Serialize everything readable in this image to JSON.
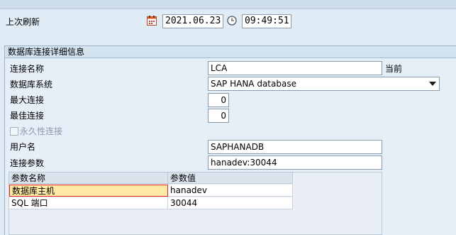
{
  "header": {
    "last_refresh_label": "上次刷新",
    "date": "2021.06.23",
    "time": "09:49:51"
  },
  "details": {
    "title": "数据库连接详细信息",
    "connection_name": {
      "label": "连接名称",
      "value": "LCA",
      "suffix": "当前"
    },
    "db_system": {
      "label": "数据库系统",
      "value": "SAP HANA database"
    },
    "max_connections": {
      "label": "最大连接",
      "value": "0"
    },
    "optimal_connections": {
      "label": "最佳连接",
      "value": "0"
    },
    "permanent": {
      "label": "永久性连接",
      "checked": false
    },
    "user_name": {
      "label": "用户名",
      "value": "SAPHANADB"
    },
    "conn_params": {
      "label": "连接参数",
      "value": "hanadev:30044"
    }
  },
  "param_table": {
    "columns": [
      "参数名称",
      "参数值"
    ],
    "rows": [
      [
        "数据库主机",
        "hanadev"
      ],
      [
        "SQL 端口",
        "30044"
      ]
    ]
  }
}
